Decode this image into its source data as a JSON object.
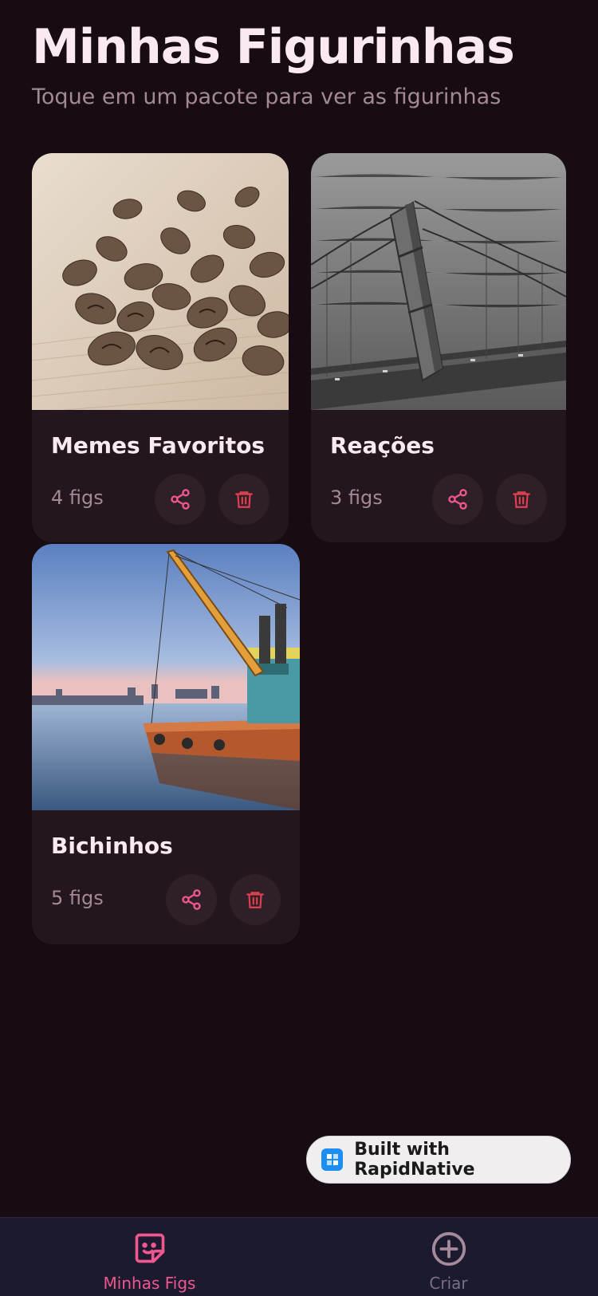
{
  "header": {
    "title": "Minhas Figurinhas",
    "subtitle": "Toque em um pacote para ver as figurinhas"
  },
  "packs": [
    {
      "name": "Memes Favoritos",
      "count": "4 figs",
      "image": "coffee-beans-photo"
    },
    {
      "name": "Reações",
      "count": "3 figs",
      "image": "bridge-tower-photo"
    },
    {
      "name": "Bichinhos",
      "count": "5 figs",
      "image": "crane-barge-photo"
    }
  ],
  "actions": {
    "share_icon": "share-icon",
    "delete_icon": "trash-icon"
  },
  "badge": {
    "label": "Built with RapidNative"
  },
  "tabs": [
    {
      "label": "Minhas Figs",
      "icon": "sticker-icon",
      "active": true
    },
    {
      "label": "Criar",
      "icon": "plus-circle-icon",
      "active": false
    }
  ],
  "colors": {
    "accent": "#f0578f",
    "delete": "#e0404f",
    "background": "#180c14",
    "card": "#23161e"
  }
}
